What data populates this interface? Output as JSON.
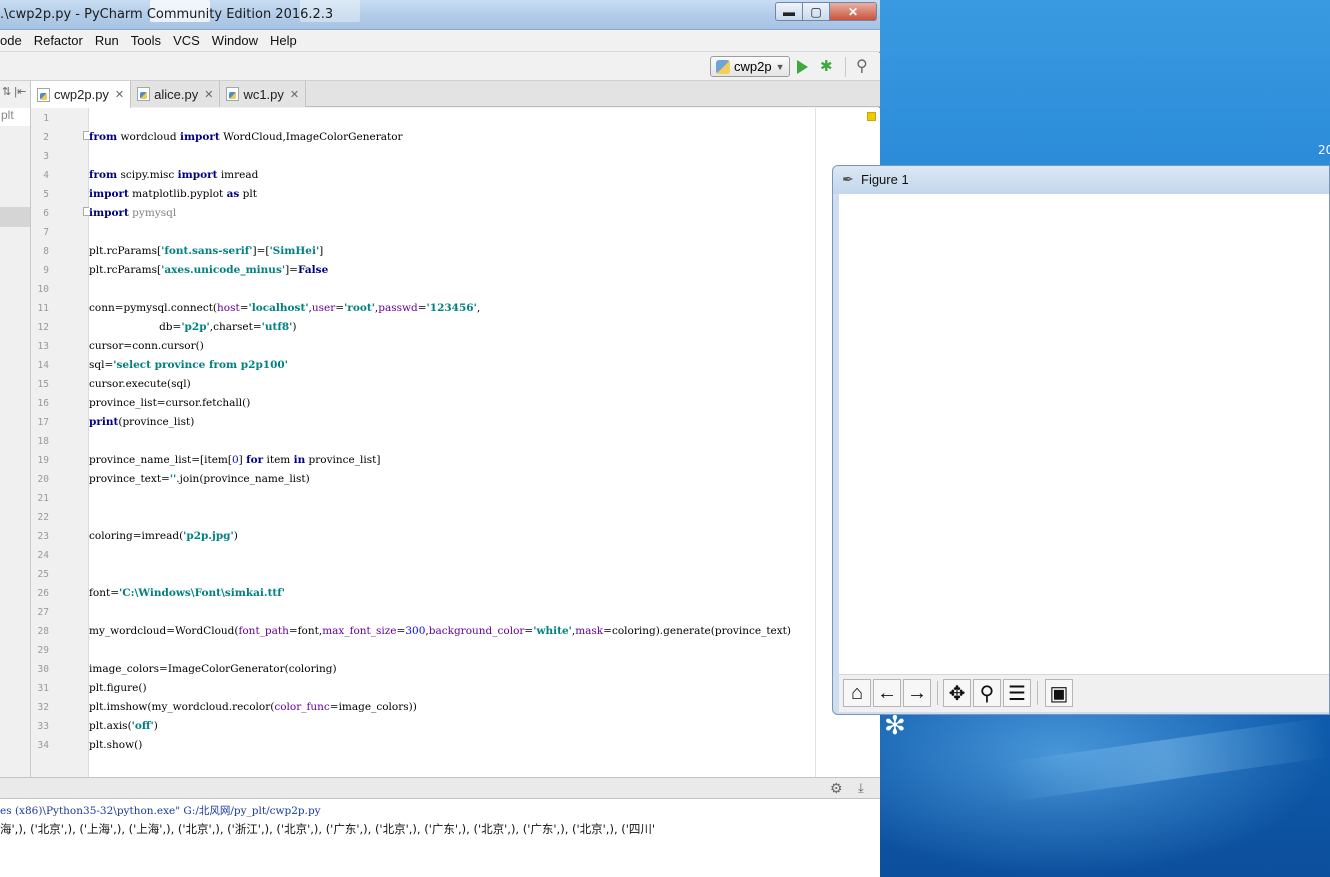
{
  "window": {
    "title": ".\\cwp2p.py - PyCharm Community Edition 2016.2.3",
    "min_label": "▬",
    "max_label": "▢",
    "close_label": "✕"
  },
  "menu": [
    "ode",
    "Refactor",
    "Run",
    "Tools",
    "VCS",
    "Window",
    "Help"
  ],
  "toolbar": {
    "run_config": "cwp2p"
  },
  "sidebar": {
    "fragment": "plt"
  },
  "tabs": [
    {
      "label": "cwp2p.py",
      "active": true
    },
    {
      "label": "alice.py",
      "active": false
    },
    {
      "label": "wc1.py",
      "active": false
    }
  ],
  "editor": {
    "highlighted_line": 26,
    "line_numbers": [
      "1",
      "2",
      "3",
      "4",
      "5",
      "6",
      "7",
      "8",
      "9",
      "10",
      "11",
      "12",
      "13",
      "14",
      "15",
      "16",
      "17",
      "18",
      "19",
      "20",
      "21",
      "22",
      "23",
      "24",
      "25",
      "26",
      "27",
      "28",
      "29",
      "30",
      "31",
      "32",
      "33",
      "34"
    ],
    "lines": [
      "",
      "from wordcloud import WordCloud,ImageColorGenerator",
      "",
      "from scipy.misc import imread",
      "import matplotlib.pyplot as plt",
      "import pymysql",
      "",
      "plt.rcParams['font.sans-serif']=['SimHei']",
      "plt.rcParams['axes.unicode_minus']=False",
      "",
      "conn=pymysql.connect(host='localhost',user='root',passwd='123456',",
      "                     db='p2p',charset='utf8')",
      "cursor=conn.cursor()",
      "sql='select province from p2p100'",
      "cursor.execute(sql)",
      "province_list=cursor.fetchall()",
      "print(province_list)",
      "",
      "province_name_list=[item[0] for item in province_list]",
      "province_text=''.join(province_name_list)",
      "",
      "",
      "coloring=imread('p2p.jpg')",
      "",
      "",
      "font='C:\\Windows\\Font\\simkai.ttf'",
      "",
      "my_wordcloud=WordCloud(font_path=font,max_font_size=300,background_color='white',mask=coloring).generate(province_text)",
      "",
      "image_colors=ImageColorGenerator(coloring)",
      "plt.figure()",
      "plt.imshow(my_wordcloud.recolor(color_func=image_colors))",
      "plt.axis('off')",
      "plt.show()"
    ]
  },
  "console": {
    "command": "es (x86)\\Python35-32\\python.exe\" G:/北风网/py_plt/cwp2p.py",
    "output": "海',), ('北京',), ('上海',), ('上海',), ('北京',), ('浙江',), ('北京',), ('广东',), ('北京',), ('广东',), ('北京',), ('广东',), ('北京',), ('四川'"
  },
  "figure": {
    "title": "Figure 1",
    "tools": [
      "home-icon",
      "back-icon",
      "forward-icon",
      "pan-icon",
      "zoom-icon",
      "subplots-icon",
      "save-icon"
    ]
  },
  "desktop": {
    "clock_fragment": "20"
  },
  "colors": {
    "keyword": "#000080",
    "string": "#008080",
    "param": "#660099",
    "number": "#0000ff",
    "current_line": "#fdf8df",
    "run_green": "#3eaa3e"
  }
}
